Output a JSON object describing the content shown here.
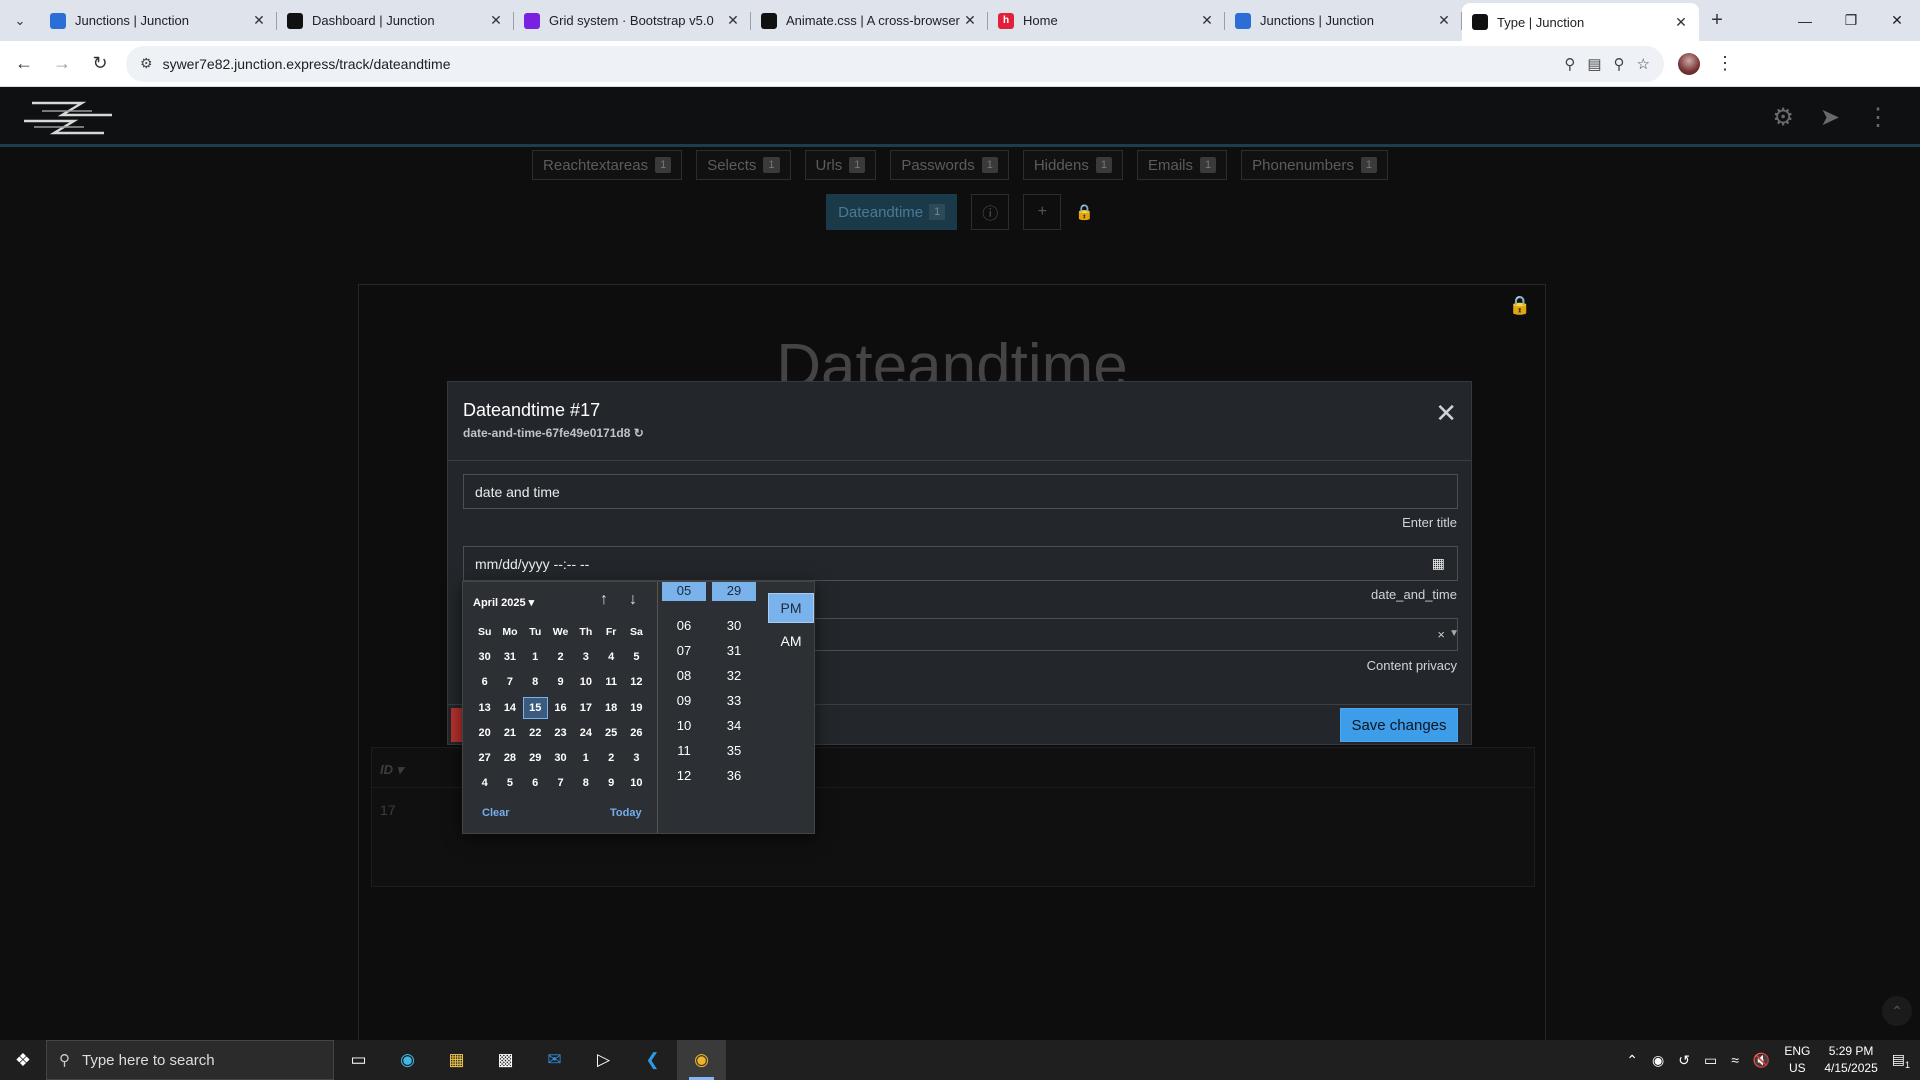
{
  "browser": {
    "tabs": [
      {
        "title": "Junctions | Junction",
        "favicon": "junction-logo-icon",
        "color": "#2b6fd6"
      },
      {
        "title": "Dashboard | Junction",
        "favicon": "junction-dark-icon",
        "color": "#111"
      },
      {
        "title": "Grid system · Bootstrap v5.0",
        "favicon": "bootstrap-icon",
        "color": "#7a20e0"
      },
      {
        "title": "Animate.css | A cross-browser library",
        "favicon": "animate-icon",
        "color": "#111"
      },
      {
        "title": "Home",
        "favicon": "home-red-icon",
        "color": "#e0213a"
      },
      {
        "title": "Junctions | Junction",
        "favicon": "junction-logo-icon",
        "color": "#2b6fd6"
      },
      {
        "title": "Type | Junction",
        "favicon": "junction-dark-icon",
        "color": "#111",
        "active": true
      }
    ],
    "url": "sywer7e82.junction.express/track/dateandtime"
  },
  "types_row": [
    {
      "label": "Reachtextareas",
      "count": "1"
    },
    {
      "label": "Selects",
      "count": "1"
    },
    {
      "label": "Urls",
      "count": "1"
    },
    {
      "label": "Passwords",
      "count": "1"
    },
    {
      "label": "Hiddens",
      "count": "1"
    },
    {
      "label": "Emails",
      "count": "1"
    },
    {
      "label": "Phonenumbers",
      "count": "1"
    }
  ],
  "active_type": {
    "label": "Dateandtime",
    "count": "1"
  },
  "panel": {
    "title": "Dateandtime",
    "table_header": "ID ▾",
    "table_row_id": "17"
  },
  "modal": {
    "title": "Dateandtime #17",
    "subtitle": "date-and-time-67fe49e0171d8",
    "title_input_value": "date and time",
    "title_help": "Enter title",
    "datetime_value": "mm/dd/yyyy --:-- --",
    "datetime_help": "date_and_time",
    "privacy_help": "Content privacy",
    "privacy_clear": "×",
    "save_label": "Save changes"
  },
  "picker": {
    "month": "April 2025",
    "dow": [
      "Su",
      "Mo",
      "Tu",
      "We",
      "Th",
      "Fr",
      "Sa"
    ],
    "weeks": [
      [
        "30",
        "31",
        "1",
        "2",
        "3",
        "4",
        "5"
      ],
      [
        "6",
        "7",
        "8",
        "9",
        "10",
        "11",
        "12"
      ],
      [
        "13",
        "14",
        "15",
        "16",
        "17",
        "18",
        "19"
      ],
      [
        "20",
        "21",
        "22",
        "23",
        "24",
        "25",
        "26"
      ],
      [
        "27",
        "28",
        "29",
        "30",
        "1",
        "2",
        "3"
      ],
      [
        "4",
        "5",
        "6",
        "7",
        "8",
        "9",
        "10"
      ]
    ],
    "selected_day": "15",
    "clear_label": "Clear",
    "today_label": "Today",
    "hours": [
      "05",
      "06",
      "07",
      "08",
      "09",
      "10",
      "11",
      "12"
    ],
    "selected_hour": "05",
    "minutes": [
      "29",
      "30",
      "31",
      "32",
      "33",
      "34",
      "35",
      "36"
    ],
    "selected_minute": "29",
    "ampm": [
      "PM",
      "AM"
    ],
    "selected_ampm": "PM"
  },
  "taskbar": {
    "search_placeholder": "Type here to search",
    "lang_1": "ENG",
    "lang_2": "US",
    "time": "5:29 PM",
    "date": "4/15/2025",
    "notif_count": "1"
  },
  "colors": {
    "accent": "#3d9de8",
    "picker_select": "#7ab3ec",
    "modal_bg": "#23272b"
  }
}
